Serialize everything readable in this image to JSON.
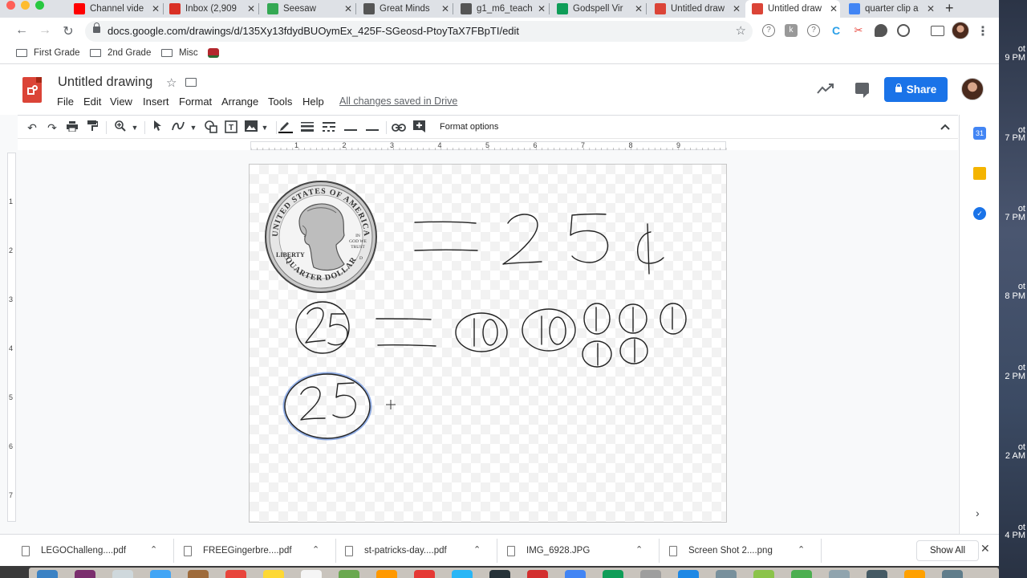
{
  "tabs": [
    {
      "title": "Channel vide",
      "color": "#ff0000"
    },
    {
      "title": "Inbox (2,909",
      "color": "#d93025"
    },
    {
      "title": "Seesaw",
      "color": "#34a853"
    },
    {
      "title": "Great Minds",
      "color": "#555555"
    },
    {
      "title": "g1_m6_teach",
      "color": "#555555"
    },
    {
      "title": "Godspell Vir",
      "color": "#0f9d58"
    },
    {
      "title": "Untitled draw",
      "color": "#db4437"
    },
    {
      "title": "Untitled draw",
      "color": "#db4437"
    },
    {
      "title": "quarter clip a",
      "color": "#4285f4"
    }
  ],
  "address_bar": {
    "url": "docs.google.com/drawings/d/135Xy13fdydBUOymEx_425F-SGeosd-PtoyTaX7FBpTI/edit"
  },
  "bookmarks": [
    "First Grade",
    "2nd Grade",
    "Misc"
  ],
  "document": {
    "title": "Untitled drawing",
    "save_status": "All changes saved in Drive"
  },
  "menu": [
    "File",
    "Edit",
    "View",
    "Insert",
    "Format",
    "Arrange",
    "Tools",
    "Help"
  ],
  "share_label": "Share",
  "toolbar": {
    "format_options": "Format options"
  },
  "ruler_h": [
    "1",
    "2",
    "3",
    "4",
    "5",
    "6",
    "7",
    "8",
    "9"
  ],
  "ruler_v": [
    "1",
    "2",
    "3",
    "4",
    "5",
    "6",
    "7"
  ],
  "canvas": {
    "coin": {
      "top_text": "UNITED STATES OF AMERICA",
      "bottom_text": "QUARTER DOLLAR",
      "left_text": "LIBERTY",
      "motto_1": "IN",
      "motto_2": "GOD WE",
      "motto_3": "TRUST",
      "mint": "D"
    },
    "ink_color": "#222222",
    "highlight_color": "#3b6fd6"
  },
  "side_panel": {
    "calendar_day": "31"
  },
  "downloads": [
    "LEGOChalleng....pdf",
    "FREEGingerbre....pdf",
    "st-patricks-day....pdf",
    "IMG_6928.JPG",
    "Screen Shot 2....png"
  ],
  "show_all": "Show All",
  "desktop_labels": [
    "ot",
    "9 PM",
    "ot",
    "7 PM",
    "ot",
    "7 PM",
    "ot",
    "8 PM",
    "ot",
    "2 PM",
    "ot",
    "2 AM",
    "ot",
    "4 PM"
  ]
}
